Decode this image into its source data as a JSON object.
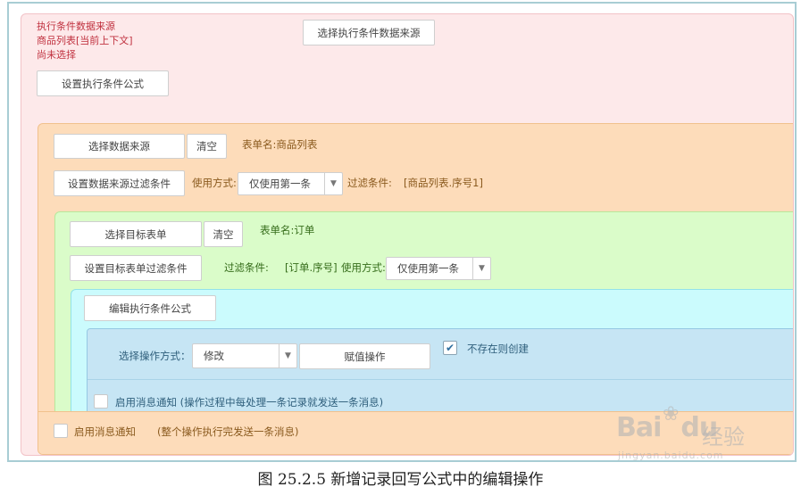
{
  "pink": {
    "info_title": "执行条件数据来源",
    "info_context": "商品列表[当前上下文]",
    "info_status": "尚未选择",
    "select_source_button": "选择执行条件数据来源",
    "set_formula_button": "设置执行条件公式"
  },
  "orange": {
    "select_source_button": "选择数据来源",
    "clear_button": "清空",
    "table_name": "表单名:商品列表",
    "set_filter_button": "设置数据来源过滤条件",
    "usage_label": "使用方式:",
    "usage_value": "仅使用第一条",
    "filter_label": "过滤条件:",
    "filter_value": "[商品列表.序号1]",
    "bottom_checkbox_label": "启用消息通知",
    "bottom_checkbox_note": "(整个操作执行完发送一条消息)"
  },
  "green": {
    "select_target_button": "选择目标表单",
    "clear_button": "清空",
    "table_name": "表单名:订单",
    "set_filter_button": "设置目标表单过滤条件",
    "filter_label": "过滤条件:",
    "filter_value": "[订单.序号]",
    "usage_label": "使用方式:",
    "usage_value": "仅使用第一条"
  },
  "cyan": {
    "edit_formula_button": "编辑执行条件公式"
  },
  "blue": {
    "op_label": "选择操作方式：",
    "op_value": "修改",
    "assign_button": "赋值操作",
    "create_label": "不存在则创建",
    "create_checked": true,
    "notify_label": "启用消息通知 (操作过程中每处理一条记录就发送一条消息)"
  },
  "caption": "图 25.2.5  新增记录回写公式中的编辑操作",
  "watermark": {
    "logo": "Bai",
    "logo2": "du",
    "cn": "经验",
    "sub": "jingyan.baidu.com"
  }
}
